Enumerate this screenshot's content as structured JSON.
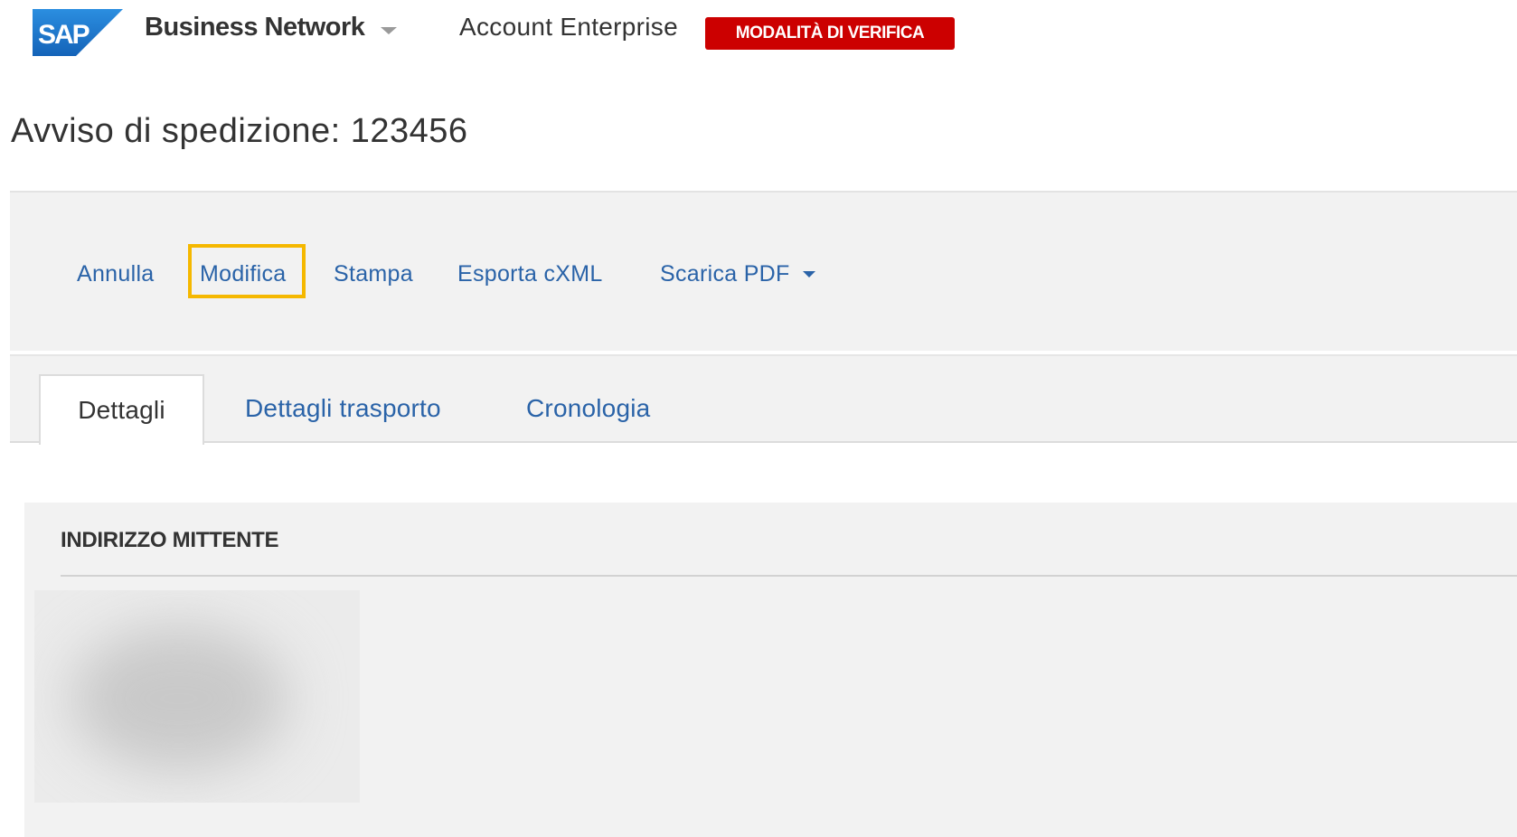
{
  "header": {
    "logo_text": "SAP",
    "product_name": "Business Network",
    "account_type": "Account Enterprise",
    "test_mode_badge": "MODALITÀ DI VERIFICA",
    "colors": {
      "logo_blue": "#1a73c8",
      "badge_red": "#cc0000"
    }
  },
  "page": {
    "title": "Avviso di spedizione: 123456"
  },
  "toolbar": {
    "cancel_label": "Annulla",
    "edit_label": "Modifica",
    "print_label": "Stampa",
    "export_label": "Esporta cXML",
    "download_pdf_label": "Scarica PDF",
    "highlighted_action": "Modifica",
    "colors": {
      "link": "#2a63a8",
      "highlight": "#f5b800"
    }
  },
  "tabs": [
    {
      "label": "Dettagli",
      "active": true
    },
    {
      "label": "Dettagli trasporto",
      "active": false
    },
    {
      "label": "Cronologia",
      "active": false
    }
  ],
  "sections": {
    "ship_from": {
      "title": "INDIRIZZO MITTENTE"
    }
  }
}
